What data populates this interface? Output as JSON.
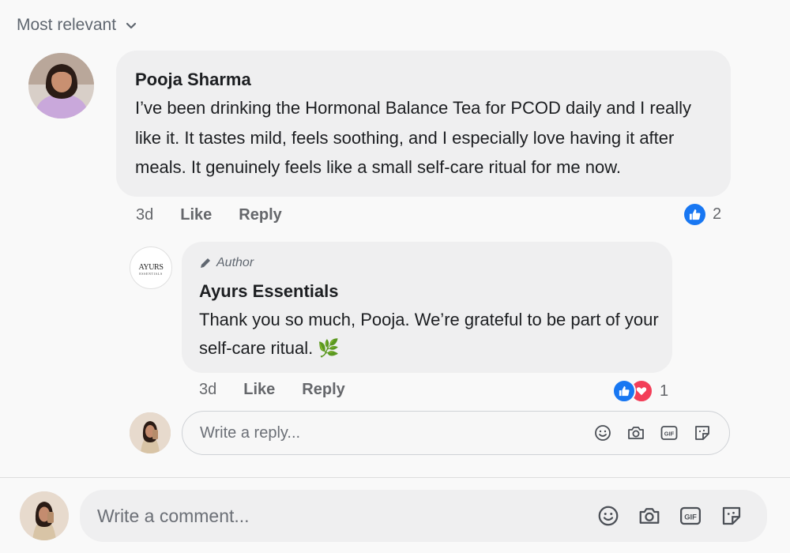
{
  "sort": {
    "label": "Most relevant",
    "icon": "chevron-down-icon"
  },
  "comment": {
    "author": "Pooja Sharma",
    "text_lines": [
      "I’ve been drinking the Hormonal Balance Tea for PCOD daily and I really",
      "like it. It tastes mild, feels soothing, and I especially love having it after",
      "meals. It genuinely feels like a small self-care ritual for me now."
    ],
    "time": "3d",
    "like_label": "Like",
    "reply_label": "Reply",
    "reaction_count": "2",
    "reaction_icons": [
      "like-icon"
    ]
  },
  "reply": {
    "badge": "Author",
    "author": "Ayurs Essentials",
    "logo_text": "AYURS",
    "logo_subtext": "ESSENTIALS",
    "text_lines": [
      "Thank you so much, Pooja. We’re grateful to be part of your",
      "self-care ritual. 🌿"
    ],
    "time": "3d",
    "like_label": "Like",
    "reply_label": "Reply",
    "reaction_count": "1",
    "reaction_icons": [
      "like-icon",
      "love-icon"
    ]
  },
  "reply_input": {
    "placeholder": "Write a reply..."
  },
  "comment_input": {
    "placeholder": "Write a comment..."
  },
  "input_icons": [
    "emoji-icon",
    "camera-icon",
    "gif-icon",
    "sticker-icon"
  ],
  "colors": {
    "like_blue": "#1877f2",
    "love_red": "#f33e58",
    "muted_text": "#65676b",
    "bubble_bg": "#efeff0"
  }
}
